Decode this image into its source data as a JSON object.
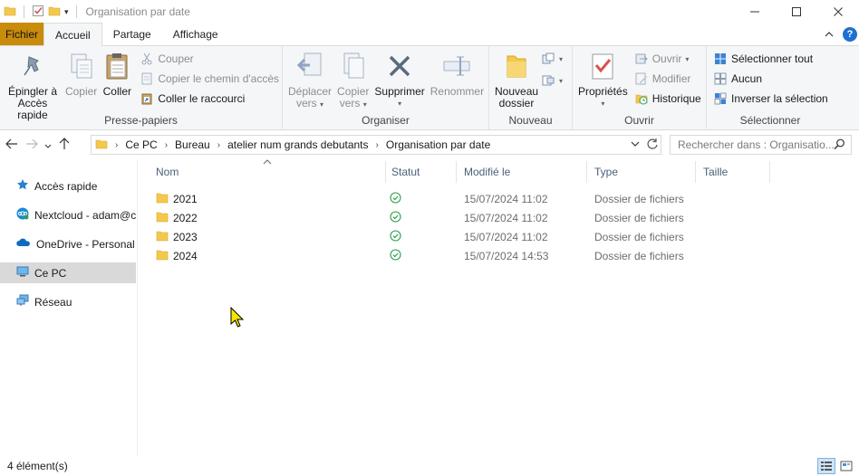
{
  "window": {
    "title": "Organisation par date",
    "controls": [
      "minimize",
      "maximize",
      "close"
    ]
  },
  "ribbon_tabs": [
    "Fichier",
    "Accueil",
    "Partage",
    "Affichage"
  ],
  "ribbon": {
    "presse_papiers": {
      "label": "Presse-papiers",
      "pin_line1": "Épingler à",
      "pin_line2": "Accès rapide",
      "copy": "Copier",
      "paste": "Coller",
      "cut": "Couper",
      "copy_path": "Copier le chemin d'accès",
      "paste_shortcut": "Coller le raccourci"
    },
    "organiser": {
      "label": "Organiser",
      "move_line1": "Déplacer",
      "move_line2": "vers",
      "copyto_line1": "Copier",
      "copyto_line2": "vers",
      "delete": "Supprimer",
      "rename": "Renommer"
    },
    "nouveau": {
      "label": "Nouveau",
      "newfolder_line1": "Nouveau",
      "newfolder_line2": "dossier"
    },
    "ouvrir": {
      "label": "Ouvrir",
      "properties": "Propriétés",
      "open": "Ouvrir",
      "edit": "Modifier",
      "history": "Historique"
    },
    "selectionner": {
      "label": "Sélectionner",
      "select_all": "Sélectionner tout",
      "select_none": "Aucun",
      "invert": "Inverser la sélection"
    }
  },
  "address": {
    "breadcrumb": [
      "Ce PC",
      "Bureau",
      "atelier num grands debutants",
      "Organisation par date"
    ],
    "search_placeholder": "Rechercher dans : Organisatio..."
  },
  "nav_pane": [
    {
      "label": "Accès rapide",
      "icon": "star-icon"
    },
    {
      "label": "Nextcloud - adam@c",
      "icon": "nextcloud-icon"
    },
    {
      "label": "OneDrive - Personal",
      "icon": "onedrive-icon"
    },
    {
      "label": "Ce PC",
      "icon": "pc-icon",
      "selected": true
    },
    {
      "label": "Réseau",
      "icon": "network-icon"
    }
  ],
  "columns": [
    "Nom",
    "Statut",
    "Modifié le",
    "Type",
    "Taille"
  ],
  "files": [
    {
      "name": "2021",
      "date": "15/07/2024 11:02",
      "type": "Dossier de fichiers"
    },
    {
      "name": "2022",
      "date": "15/07/2024 11:02",
      "type": "Dossier de fichiers"
    },
    {
      "name": "2023",
      "date": "15/07/2024 11:02",
      "type": "Dossier de fichiers"
    },
    {
      "name": "2024",
      "date": "15/07/2024 14:53",
      "type": "Dossier de fichiers"
    }
  ],
  "status": {
    "count": "4 élément(s)"
  },
  "colors": {
    "file_tab": "#c98b0b",
    "folder": "#f2c94c",
    "status_ok": "#2e9e4f",
    "selection": "#d9d9d9"
  }
}
